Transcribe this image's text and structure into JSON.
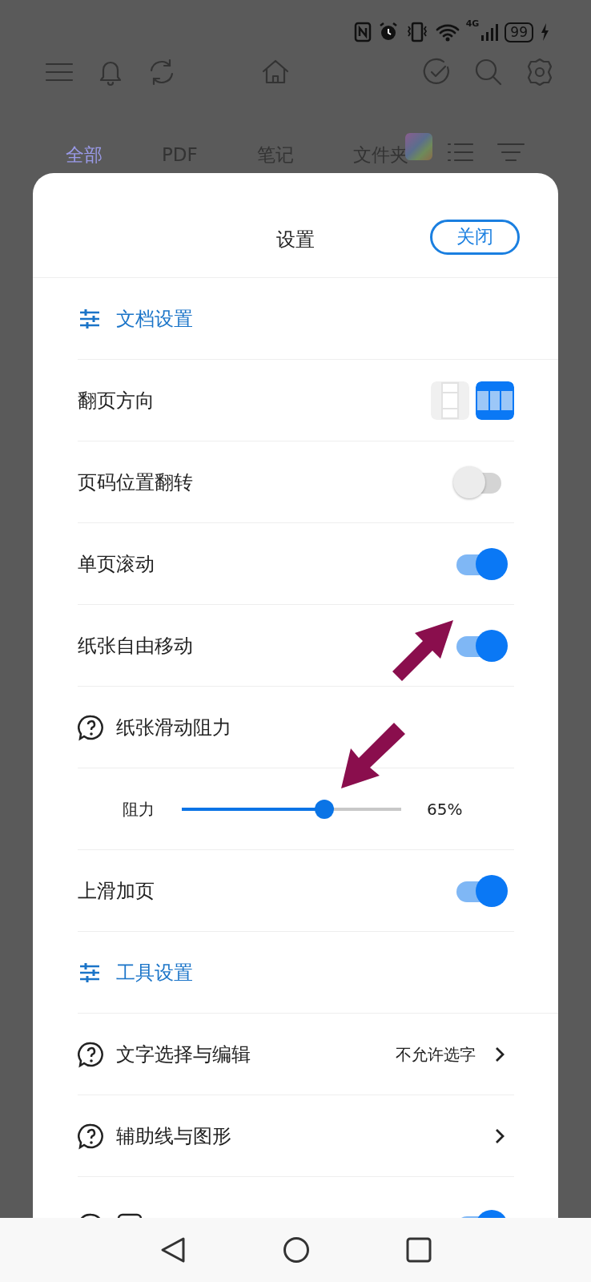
{
  "status_bar": {
    "network": "4G",
    "battery": "99"
  },
  "tabs": [
    {
      "label": "全部",
      "selected": true
    },
    {
      "label": "PDF",
      "selected": false
    },
    {
      "label": "笔记",
      "selected": false
    },
    {
      "label": "文件夹",
      "selected": false
    }
  ],
  "dialog": {
    "title": "设置",
    "close_button": "关闭",
    "sections": [
      {
        "title": "文档设置",
        "items": [
          {
            "kind": "segmented",
            "label": "翻页方向",
            "options": [
              {
                "selected": false
              },
              {
                "selected": true
              }
            ]
          },
          {
            "kind": "toggle",
            "label": "页码位置翻转",
            "on": false
          },
          {
            "kind": "toggle",
            "label": "单页滚动",
            "on": true
          },
          {
            "kind": "toggle",
            "label": "纸张自由移动",
            "on": true
          },
          {
            "kind": "heading",
            "label": "纸张滑动阻力",
            "help": true
          },
          {
            "kind": "slider",
            "label": "阻力",
            "level": 0.65,
            "reading": "65%"
          },
          {
            "kind": "toggle",
            "label": "上滑加页",
            "on": true
          }
        ]
      },
      {
        "title": "工具设置",
        "items": [
          {
            "kind": "link",
            "label": "文字选择与编辑",
            "help": true,
            "value": "不允许选字"
          },
          {
            "kind": "link",
            "label": "辅助线与图形",
            "help": true
          },
          {
            "kind": "partial",
            "help": true,
            "on": true
          }
        ]
      }
    ]
  }
}
